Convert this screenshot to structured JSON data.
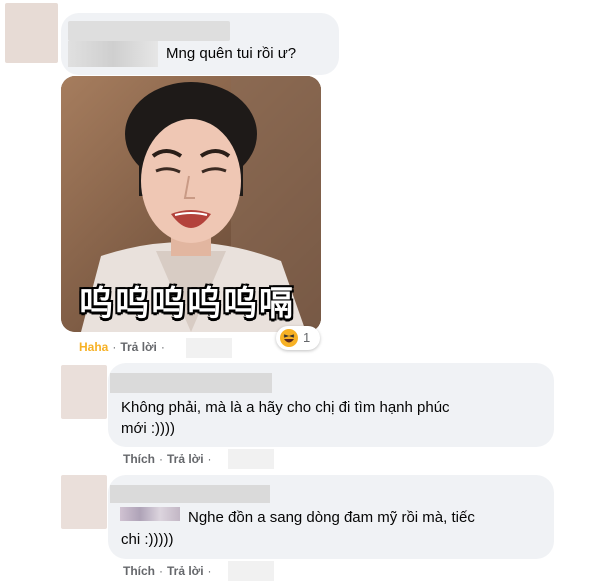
{
  "comments": [
    {
      "text": "Mng quên tui rồi ư?",
      "reaction_label": "Haha",
      "reply_label": "Trả lời",
      "sticker_caption": "呜呜呜呜呜嗝",
      "reaction_count": "1",
      "reaction_icon": "haha-emoji-icon"
    },
    {
      "text_line1": "Không phải, mà là a hãy cho chị đi tìm hạnh phúc",
      "text_line2": "mới :))))",
      "like_label": "Thích",
      "reply_label": "Trả lời"
    },
    {
      "text_line1": "Nghe đồn a sang dòng đam mỹ rồi mà, tiếc",
      "text_line2": "chi :)))))",
      "like_label": "Thích",
      "reply_label": "Trả lời"
    }
  ],
  "separator": "·",
  "colors": {
    "bubble": "#f0f2f5",
    "haha": "#f7b125",
    "meta": "#65676b",
    "avatar": "#e8dcd6"
  }
}
